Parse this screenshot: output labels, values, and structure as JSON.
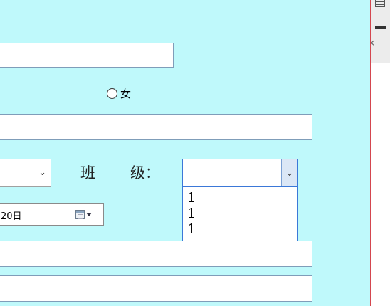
{
  "form": {
    "gender_option_female": "女",
    "class_label": {
      "ch1": "班",
      "ch2": "级："
    },
    "class_select_value": "",
    "class_options": [
      "1",
      "1",
      "1"
    ],
    "date_value": "20日",
    "left_select_value": ""
  },
  "icons": {
    "right_panel": [
      "grid-icon",
      "minus-bar-icon",
      "chevron-left-icon"
    ],
    "date_picker": "calendar-icon"
  },
  "colors": {
    "form_background": "#bff9fb",
    "focus_border": "#3b78d8",
    "panel_border": "#d4464f"
  }
}
